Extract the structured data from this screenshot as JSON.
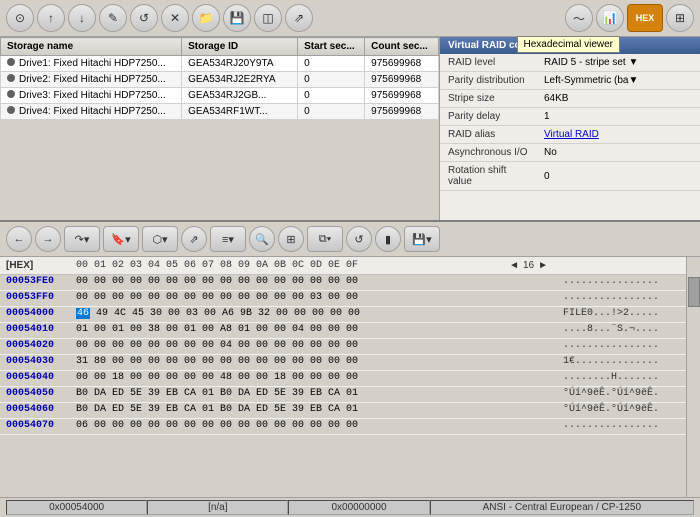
{
  "toolbar": {
    "buttons": [
      {
        "name": "disk-icon",
        "symbol": "⊙"
      },
      {
        "name": "up-icon",
        "symbol": "↑"
      },
      {
        "name": "down-icon",
        "symbol": "↓"
      },
      {
        "name": "edit-icon",
        "symbol": "✎"
      },
      {
        "name": "undo-icon",
        "symbol": "↺"
      },
      {
        "name": "close-icon",
        "symbol": "✕"
      },
      {
        "name": "open-icon",
        "symbol": "📁"
      },
      {
        "name": "save-icon",
        "symbol": "💾"
      },
      {
        "name": "layers-icon",
        "symbol": "◫"
      },
      {
        "name": "export-icon",
        "symbol": "↗"
      }
    ],
    "right_buttons": [
      {
        "name": "signal-icon",
        "symbol": "~"
      },
      {
        "name": "chart-icon",
        "symbol": "📊"
      },
      {
        "name": "hex-icon",
        "symbol": "HEX",
        "active": true
      },
      {
        "name": "table-icon",
        "symbol": "⊞"
      }
    ],
    "hex_tooltip": "Hexadecimal viewer"
  },
  "storage_table": {
    "headers": [
      "Storage name",
      "Storage ID",
      "Start sec...",
      "Count sec..."
    ],
    "rows": [
      {
        "name": "Drive1: Fixed Hitachi HDP7250...",
        "id": "GEA534RJ20Y9TA",
        "start": "0",
        "count": "975699968"
      },
      {
        "name": "Drive2: Fixed Hitachi HDP7250...",
        "id": "GEA534RJ2E2RYA",
        "start": "0",
        "count": "975699968"
      },
      {
        "name": "Drive3: Fixed Hitachi HDP7250...",
        "id": "GEA534RJ2GB...",
        "start": "0",
        "count": "975699968"
      },
      {
        "name": "Drive4: Fixed Hitachi HDP7250...",
        "id": "GEA534RF1WT...",
        "start": "0",
        "count": "975699968"
      }
    ]
  },
  "raid_panel": {
    "header": "Virtual RAID configuration",
    "rows": [
      {
        "label": "RAID level",
        "value": "RAID 5 - stripe set ▼",
        "link": false
      },
      {
        "label": "Parity distribution",
        "value": "Left-Symmetric (ba▼",
        "link": false
      },
      {
        "label": "Stripe size",
        "value": "64KB",
        "has_arrow": true,
        "link": false
      },
      {
        "label": "Parity delay",
        "value": "1",
        "has_arrow": false,
        "link": false
      },
      {
        "label": "RAID alias",
        "value": "Virtual RAID",
        "link": true
      },
      {
        "label": "Asynchronous I/O",
        "value": "No",
        "has_arrow": true,
        "link": false
      },
      {
        "label": "Rotation shift value",
        "value": "0",
        "has_arrow": false,
        "link": false
      }
    ]
  },
  "hex_toolbar": {
    "buttons": [
      {
        "name": "back-nav",
        "symbol": "←"
      },
      {
        "name": "fwd-nav",
        "symbol": "→"
      },
      {
        "name": "replay-icon",
        "symbol": "↷"
      },
      {
        "name": "bookmark-icon",
        "symbol": "🔖"
      },
      {
        "name": "select-icon",
        "symbol": "⬡"
      },
      {
        "name": "goto-icon",
        "symbol": "↗"
      },
      {
        "name": "list-icon",
        "symbol": "≡"
      },
      {
        "name": "search-icon",
        "symbol": "🔍"
      },
      {
        "name": "grid-icon",
        "symbol": "⊞"
      },
      {
        "name": "copy-icon",
        "symbol": "⧉"
      },
      {
        "name": "refresh-icon",
        "symbol": "↺"
      },
      {
        "name": "toggle-icon",
        "symbol": "▮"
      },
      {
        "name": "save2-icon",
        "symbol": "💾"
      },
      {
        "name": "more-icon",
        "symbol": "▾"
      }
    ],
    "page_size": "16"
  },
  "hex_header": {
    "label": "[HEX]",
    "cols": "00 01 02 03 04 05 06 07 08 09 0A 0B 0C 0D 0E 0F"
  },
  "hex_rows": [
    {
      "addr": "00053FE0",
      "data": "00 00 00 00 00 00 00 00 00 00 00 00 00 00 00 00",
      "text": "................"
    },
    {
      "addr": "00053FF0",
      "data": "00 00 00 00 00 00 00 00 00 00 00 00 00 03 00 00",
      "text": "................"
    },
    {
      "addr": "00054000",
      "data": "46 49 4C 45 30 00 03 00 A6 9B 32 00 00 00 00 00",
      "text": "FILE0...!>2....."
    },
    {
      "addr": "00054010",
      "data": "01 00 01 00 38 00 01 00 A8 01 00 00 04 00 00 00",
      "text": "....8...¨S.¬...."
    },
    {
      "addr": "00054020",
      "data": "00 00 00 00 00 00 00 00 04 00 00 00 00 00 00 00",
      "text": "................"
    },
    {
      "addr": "00054030",
      "data": "31 80 00 00 00 00 00 00 00 00 00 00 00 00 00 00",
      "text": "1€.............."
    },
    {
      "addr": "00054040",
      "data": "00 00 18 00 00 00 00 00 48 00 00 18 00 00 00 00",
      "text": "........H......."
    },
    {
      "addr": "00054050",
      "data": "B0 DA ED 5E 39 EB CA 01 B0 DA ED 5E 39 EB CA 01",
      "text": "°Úí^9ëÊ.°Úí^9ëÊ."
    },
    {
      "addr": "00054060",
      "data": "B0 DA ED 5E 39 EB CA 01 B0 DA ED 5E 39 EB CA 01",
      "text": "°Úí^9ëÊ.°Úí^9ëÊ."
    },
    {
      "addr": "00054070",
      "data": "06 00 00 00 00 00 00 00 00 00 00 00 00 00 00 00",
      "text": "................"
    }
  ],
  "status_bar": {
    "offset": "0x00054000",
    "value": "[n/a]",
    "position": "0x00000000",
    "encoding": "ANSI - Central European / CP-1250"
  }
}
